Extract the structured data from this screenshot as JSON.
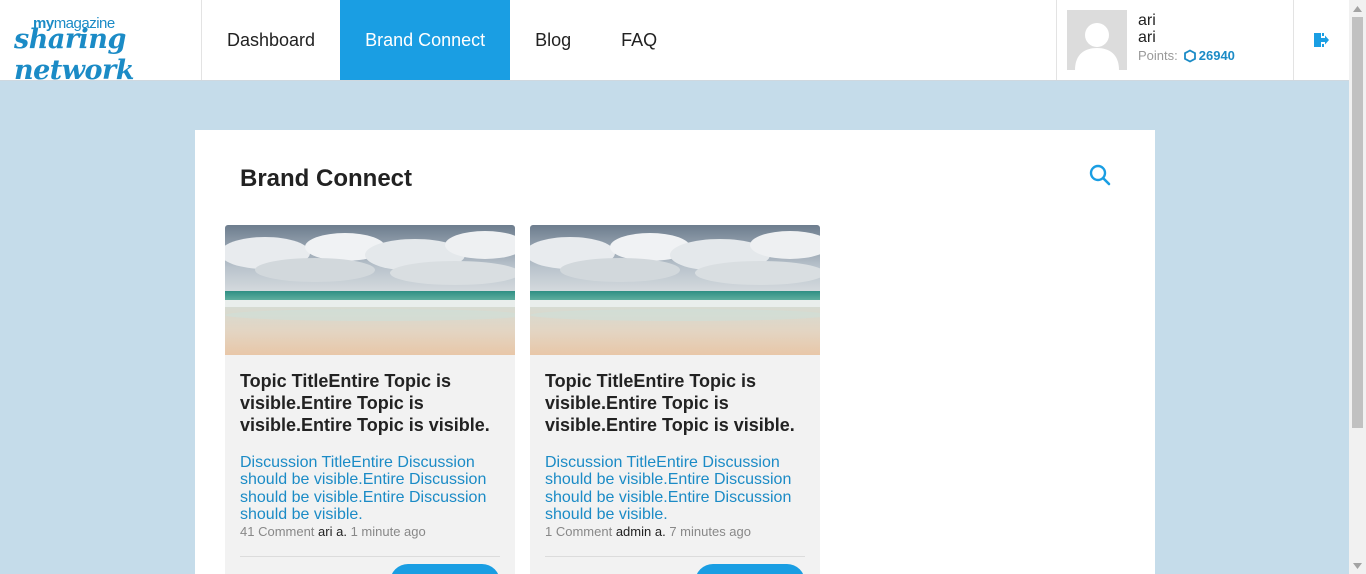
{
  "logo": {
    "line1_a": "my",
    "line1_b": "magazine",
    "line2": "sharing network"
  },
  "nav": [
    {
      "label": "Dashboard",
      "active": false
    },
    {
      "label": "Brand Connect",
      "active": true
    },
    {
      "label": "Blog",
      "active": false
    },
    {
      "label": "FAQ",
      "active": false
    }
  ],
  "user": {
    "name": "ari",
    "username": "ari",
    "points_label": "Points:",
    "points_value": "26940"
  },
  "page": {
    "title": "Brand Connect"
  },
  "cards": [
    {
      "topic_title": "Topic TitleEntire Topic is visible.Entire Topic is visible.Entire Topic is visible.",
      "discussion_title": "Discussion TitleEntire Discussion should be visible.Entire Discussion should be visible.Entire Discussion should be visible.",
      "comments": "41 Comment",
      "author": "ari a.",
      "time": "1 minute ago"
    },
    {
      "topic_title": "Topic TitleEntire Topic is visible.Entire Topic is visible.Entire Topic is visible.",
      "discussion_title": "Discussion TitleEntire Discussion should be visible.Entire Discussion should be visible.Entire Discussion should be visible.",
      "comments": "1 Comment",
      "author": "admin a.",
      "time": "7 minutes ago"
    }
  ],
  "colors": {
    "accent": "#1a9ee3",
    "link": "#1b8bc6",
    "page_bg": "#c5dcea"
  },
  "icons": {
    "search": "search-icon",
    "logout": "logout-icon",
    "points": "hexagon-icon",
    "avatar": "avatar-placeholder-icon"
  }
}
